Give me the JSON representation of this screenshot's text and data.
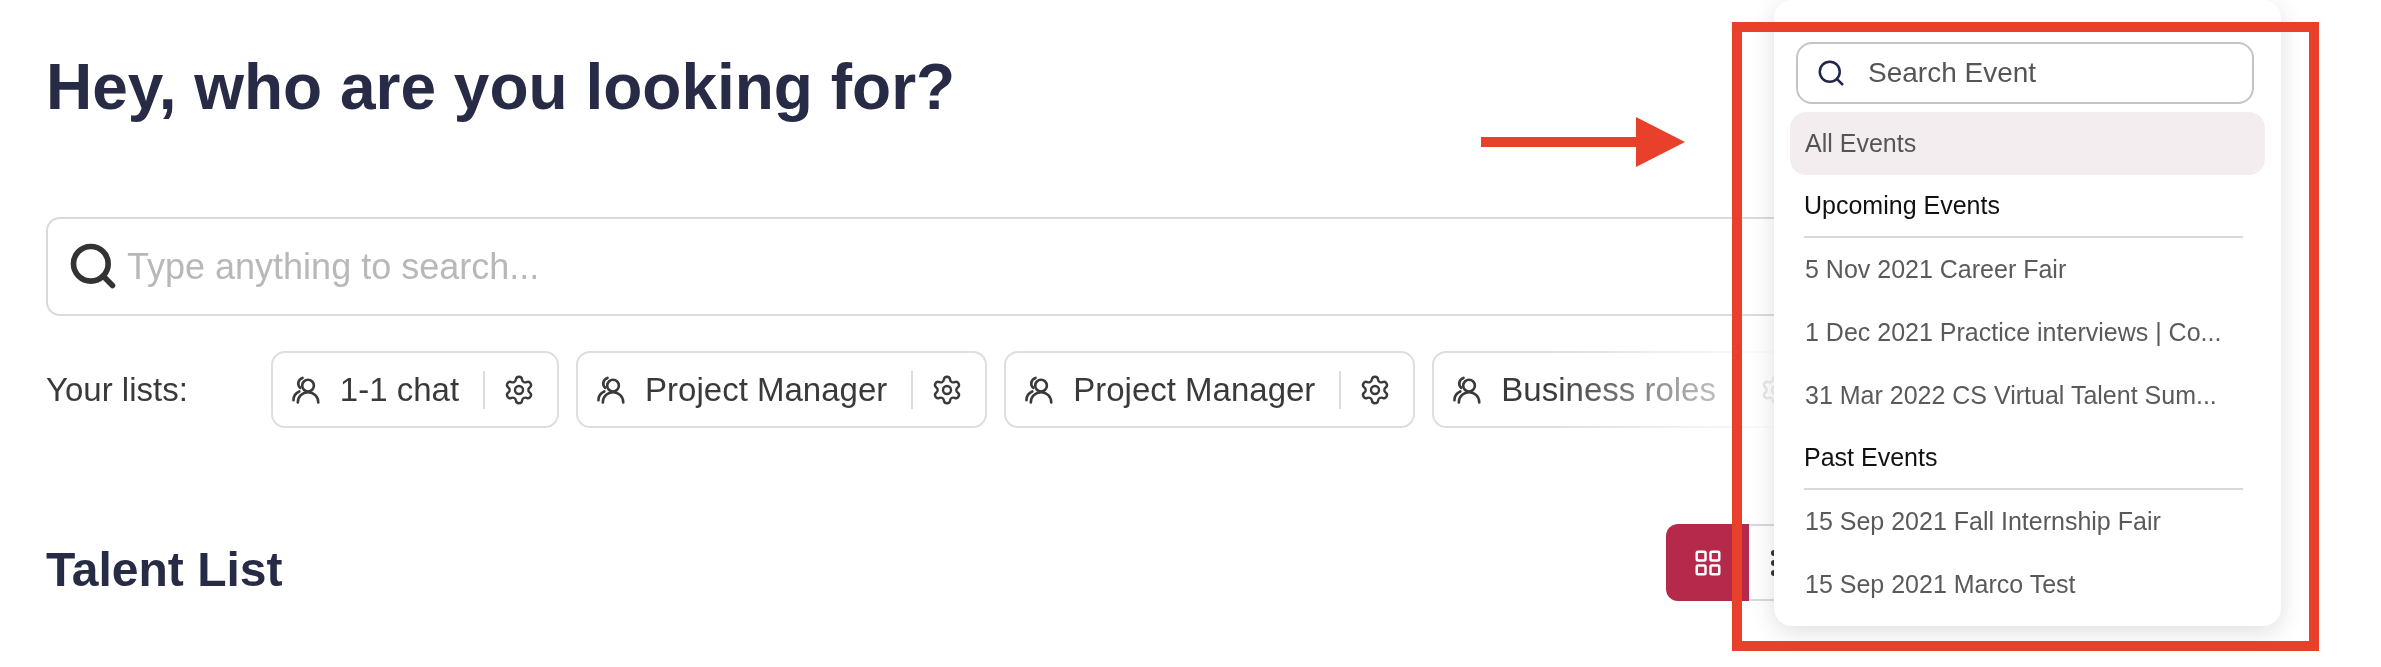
{
  "heading": "Hey, who are you looking for?",
  "search": {
    "placeholder": "Type anything to search..."
  },
  "lists": {
    "label": "Your lists:",
    "items": [
      {
        "name": "1-1 chat"
      },
      {
        "name": "Project Manager"
      },
      {
        "name": "Project Manager"
      },
      {
        "name": "Business roles"
      }
    ]
  },
  "talent_list": {
    "title": "Talent List",
    "views": [
      {
        "kind": "grid",
        "selected": true
      },
      {
        "kind": "list",
        "selected": false
      }
    ]
  },
  "event_filter": {
    "search": {
      "placeholder": "Search Event"
    },
    "items": [
      {
        "kind": "option",
        "label": "All Events",
        "selected": true
      },
      {
        "kind": "heading",
        "label": "Upcoming Events"
      },
      {
        "kind": "option",
        "label": "5 Nov 2021 Career Fair",
        "selected": false
      },
      {
        "kind": "option",
        "label": "1 Dec 2021 Practice interviews | Co...",
        "selected": false
      },
      {
        "kind": "option",
        "label": "31 Mar 2022 CS Virtual Talent Sum...",
        "selected": false
      },
      {
        "kind": "heading",
        "label": "Past Events"
      },
      {
        "kind": "option",
        "label": "15 Sep 2021 Fall Internship Fair",
        "selected": false
      },
      {
        "kind": "option",
        "label": "15 Sep 2021 Marco Test",
        "selected": false
      }
    ]
  }
}
